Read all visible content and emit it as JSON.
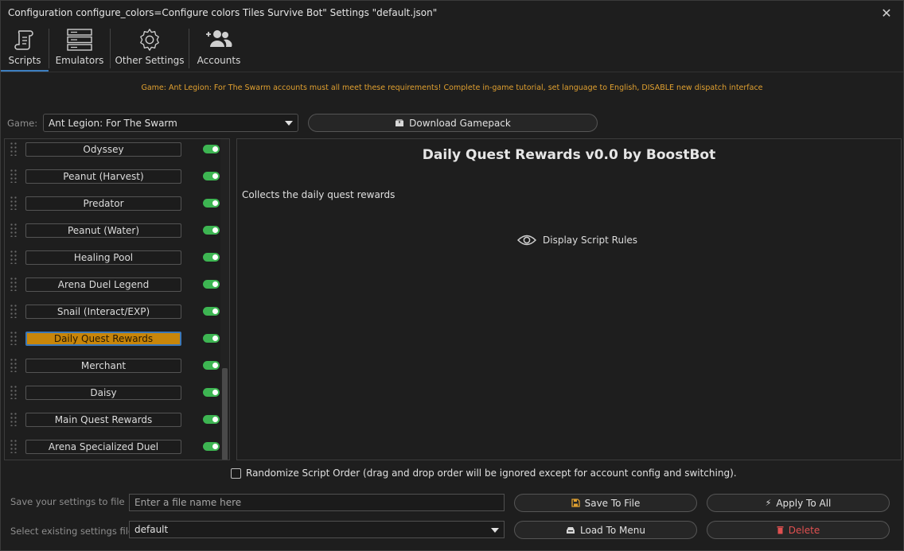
{
  "window": {
    "title": "Configuration configure_colors=Configure colors Tiles Survive Bot\" Settings \"default.json\"",
    "close_glyph": "✕"
  },
  "tabs": [
    {
      "label": "Scripts",
      "icon": "scroll-icon",
      "active": true
    },
    {
      "label": "Emulators",
      "icon": "server-icon",
      "active": false
    },
    {
      "label": "Other Settings",
      "icon": "gear-icon",
      "active": false
    },
    {
      "label": "Accounts",
      "icon": "users-add-icon",
      "active": false
    }
  ],
  "notice": "Game: Ant Legion: For The Swarm accounts must all meet these requirements! Complete in-game tutorial, set language to English, DISABLE new dispatch interface",
  "game": {
    "label": "Game:",
    "selected": "Ant Legion: For The Swarm",
    "download_label": "Download Gamepack"
  },
  "scripts": [
    {
      "name": "Odyssey",
      "enabled": true,
      "selected": false
    },
    {
      "name": "Peanut (Harvest)",
      "enabled": true,
      "selected": false
    },
    {
      "name": "Predator",
      "enabled": true,
      "selected": false
    },
    {
      "name": "Peanut (Water)",
      "enabled": true,
      "selected": false
    },
    {
      "name": "Healing Pool",
      "enabled": true,
      "selected": false
    },
    {
      "name": "Arena Duel Legend",
      "enabled": true,
      "selected": false
    },
    {
      "name": "Snail (Interact/EXP)",
      "enabled": true,
      "selected": false
    },
    {
      "name": "Daily Quest Rewards",
      "enabled": true,
      "selected": true
    },
    {
      "name": "Merchant",
      "enabled": true,
      "selected": false
    },
    {
      "name": "Daisy",
      "enabled": true,
      "selected": false
    },
    {
      "name": "Main Quest Rewards",
      "enabled": true,
      "selected": false
    },
    {
      "name": "Arena Specialized Duel",
      "enabled": true,
      "selected": false
    }
  ],
  "detail": {
    "title": "Daily Quest Rewards v0.0 by BoostBot",
    "description": "Collects the daily quest rewards",
    "rules_label": "Display Script Rules"
  },
  "randomize_label": "Randomize Script Order (drag and drop order will be ignored except for account config and switching).",
  "save": {
    "label": "Save your settings to file",
    "placeholder": "Enter a file name here",
    "save_button": "Save To File",
    "apply_button": "Apply To All"
  },
  "load": {
    "label": "Select existing settings file",
    "selected": "default",
    "load_button": "Load To Menu",
    "delete_button": "Delete"
  },
  "colors": {
    "accent_blue": "#3d7fc1",
    "selected_orange": "#c8860a",
    "toggle_green": "#3db552",
    "notice_orange": "#e0a030",
    "danger_red": "#e05050"
  }
}
